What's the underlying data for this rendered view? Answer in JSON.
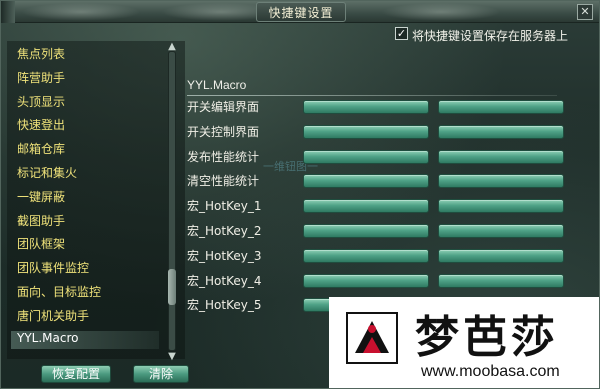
{
  "window": {
    "title": "快捷键设置",
    "close_glyph": "✕"
  },
  "checkbox": {
    "label": "将快捷键设置保存在服务器上",
    "checked": true,
    "check_glyph": "✓"
  },
  "left_list": {
    "items": [
      {
        "label": "焦点列表"
      },
      {
        "label": "阵营助手"
      },
      {
        "label": "头顶显示"
      },
      {
        "label": "快速登出"
      },
      {
        "label": "邮箱仓库"
      },
      {
        "label": "标记和集火"
      },
      {
        "label": "一键屏蔽"
      },
      {
        "label": "截图助手"
      },
      {
        "label": "团队框架"
      },
      {
        "label": "团队事件监控"
      },
      {
        "label": "面向、目标监控"
      },
      {
        "label": "唐门机关助手"
      },
      {
        "label": "YYL.Macro"
      }
    ],
    "selected": "YYL.Macro",
    "scroll_up_glyph": "▲",
    "scroll_down_glyph": "▼"
  },
  "section": {
    "title": "YYL.Macro",
    "rows": [
      {
        "label": "开关编辑界面"
      },
      {
        "label": "开关控制界面"
      },
      {
        "label": "发布性能统计"
      },
      {
        "label": "清空性能统计"
      },
      {
        "label": "宏_HotKey_1"
      },
      {
        "label": "宏_HotKey_2"
      },
      {
        "label": "宏_HotKey_3"
      },
      {
        "label": "宏_HotKey_4"
      },
      {
        "label": "宏_HotKey_5"
      }
    ],
    "faint_text": "一维钮图一"
  },
  "buttons": {
    "restore": "恢复配置",
    "clear": "清除"
  },
  "watermark": {
    "brand_cn": "梦芭莎",
    "url": "www.moobasa.com"
  }
}
